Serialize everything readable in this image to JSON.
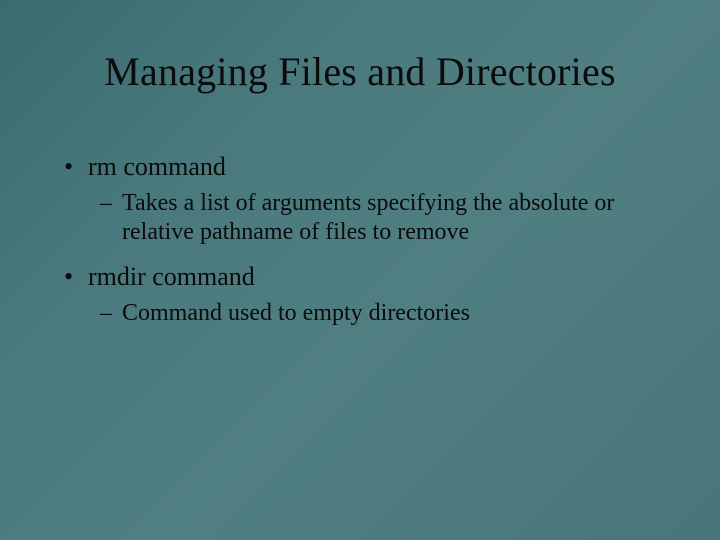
{
  "title": "Managing Files and Directories",
  "bullets": [
    {
      "level1": "rm command",
      "level2": "Takes a list of arguments specifying the absolute or relative pathname of files to remove"
    },
    {
      "level1": "rmdir command",
      "level2": "Command used to empty directories"
    }
  ]
}
